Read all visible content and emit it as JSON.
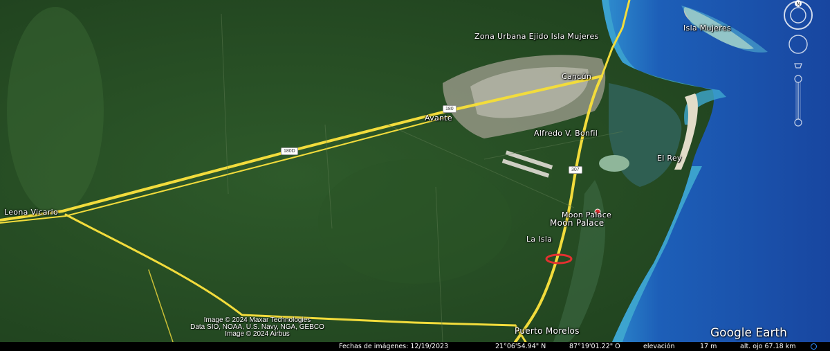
{
  "labels": {
    "isla_mujeres": "Isla Mujeres",
    "zona_urbana": "Zona Urbana Ejido Isla Mujeres",
    "cancun": "Cancún",
    "avante": "Avante",
    "alfredo": "Alfredo V. Bonfil",
    "el_rey": "El Rey",
    "leona": "Leona Vicario",
    "moon_palace_1": "Moon Palace",
    "moon_palace_2": "Moon Palace",
    "la_isla": "La Isla",
    "puerto_morelos": "Puerto Morelos"
  },
  "shields": {
    "s180": "180",
    "s180d": "180D",
    "s307": "307"
  },
  "attribution": {
    "line1": "Image © 2024 Maxar Technologies",
    "line2": "Data SIO, NOAA, U.S. Navy, NGA, GEBCO",
    "line3": "Image © 2024 Airbus"
  },
  "status_bar": {
    "imagery_date": "Fechas de imágenes: 12/19/2023",
    "lat": "21°06'54.94\" N",
    "lon": "87°19'01.22\" O",
    "elevation_label": "elevación",
    "elevation": "17 m",
    "eye_alt": "alt. ojo  67.18 km"
  },
  "logo": "Google Earth",
  "compass_label": "N",
  "colors": {
    "road": "#f2dc3c",
    "pin": "#e53030",
    "ocean": "#1d5fb8",
    "shallow": "#3fa8cf"
  }
}
